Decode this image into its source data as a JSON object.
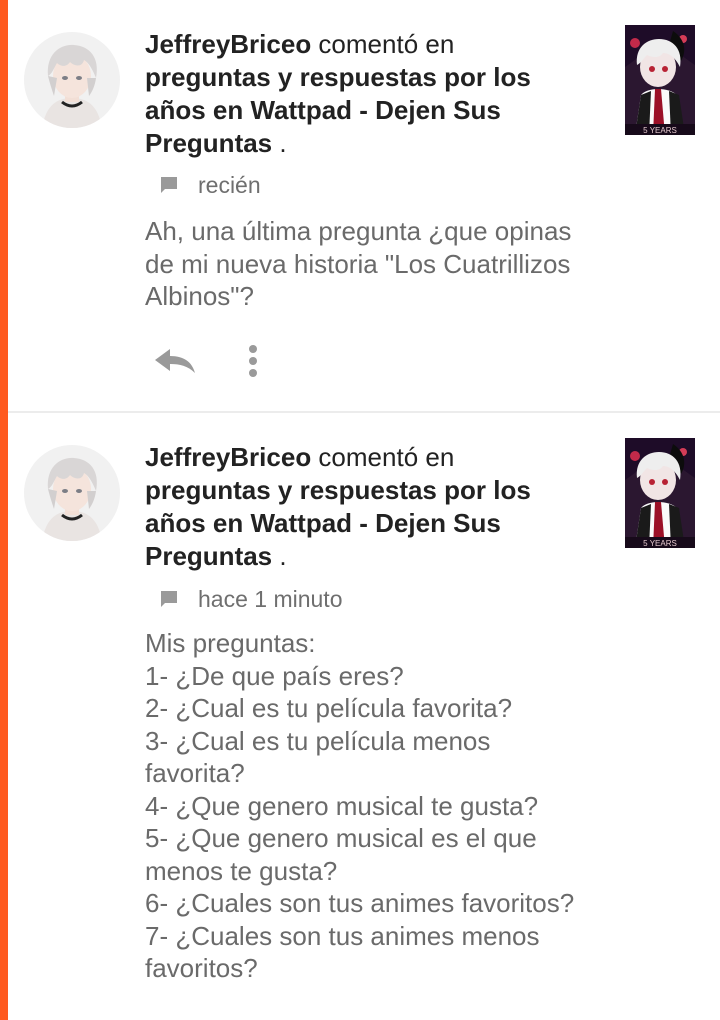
{
  "colors": {
    "accent": "#ff5a1f",
    "text_primary": "#222222",
    "text_secondary": "#6a6a6a",
    "icon_gray": "#9a9a9a",
    "divider": "#ececec"
  },
  "notifications": [
    {
      "username": "JeffreyBriceo",
      "action_text": " comentó en ",
      "story_title": "preguntas y respuestas por los años en Wattpad - Dejen Sus Preguntas",
      "title_suffix": " .",
      "timestamp": "recién",
      "message": "Ah, una última pregunta ¿que opinas de mi nueva historia \"Los Cuatrillizos Albinos\"?",
      "avatar_icon": "user-avatar",
      "meta_icon": "comment-flag-icon",
      "reply_icon": "reply-icon",
      "more_icon": "more-vertical-icon"
    },
    {
      "username": "JeffreyBriceo",
      "action_text": " comentó en ",
      "story_title": "preguntas y respuestas por los años en Wattpad - Dejen Sus Preguntas",
      "title_suffix": " .",
      "timestamp": "hace 1 minuto",
      "message": "Mis preguntas:\n1- ¿De que país eres?\n2- ¿Cual es tu película favorita?\n3- ¿Cual es tu película menos favorita?\n4- ¿Que genero musical te gusta?\n5- ¿Que genero musical es el que menos te gusta?\n6- ¿Cuales son tus animes favoritos?\n7- ¿Cuales son tus animes menos favoritos?",
      "avatar_icon": "user-avatar",
      "meta_icon": "comment-flag-icon"
    }
  ]
}
